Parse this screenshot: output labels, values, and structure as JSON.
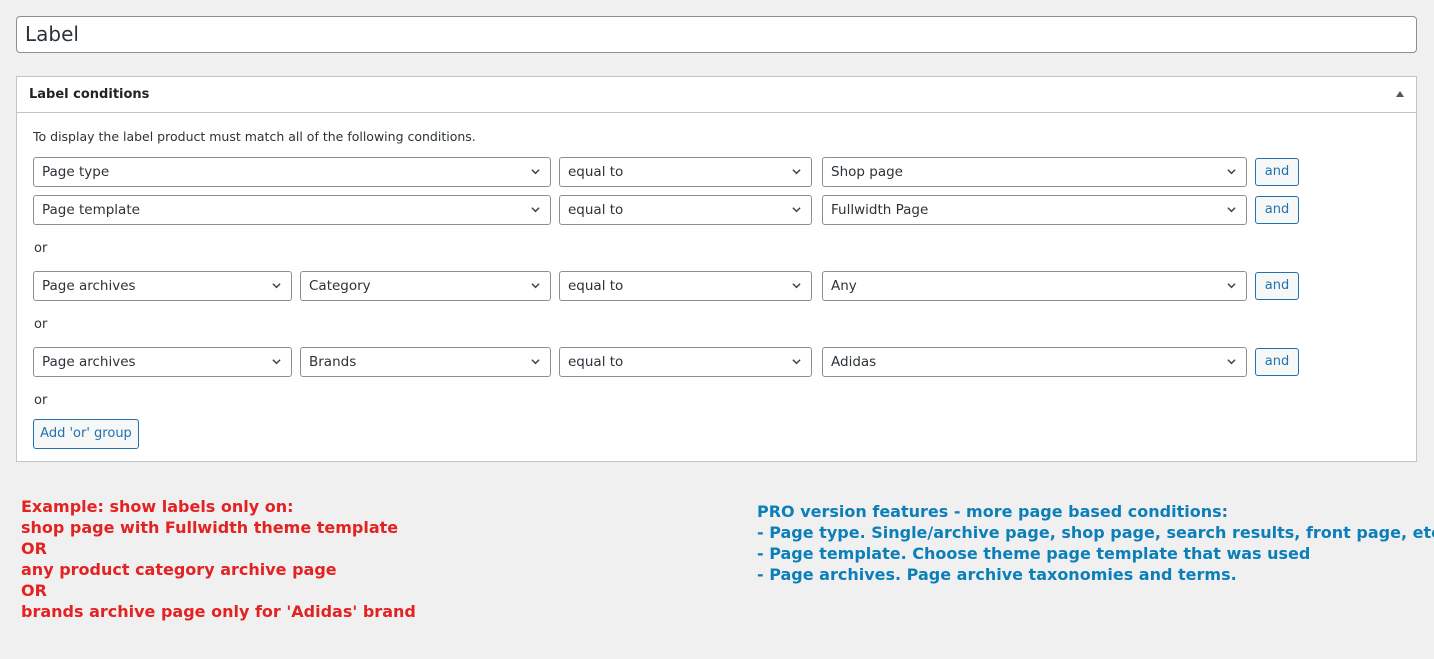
{
  "title_input": {
    "value": "Label"
  },
  "panel": {
    "title": "Label conditions",
    "intro": "To display the label product must match all of the following conditions.",
    "groups": [
      {
        "rows": [
          {
            "fields": [
              "Page type",
              "equal to",
              "Shop page"
            ],
            "and_label": "and"
          },
          {
            "fields": [
              "Page template",
              "equal to",
              "Fullwidth Page"
            ],
            "and_label": "and"
          }
        ]
      },
      {
        "rows": [
          {
            "fields": [
              "Page archives",
              "Category",
              "equal to",
              "Any"
            ],
            "and_label": "and"
          }
        ]
      },
      {
        "rows": [
          {
            "fields": [
              "Page archives",
              "Brands",
              "equal to",
              "Adidas"
            ],
            "and_label": "and"
          }
        ]
      }
    ],
    "or_label": "or",
    "add_or_group_label": "Add 'or' group"
  },
  "example": {
    "lines": [
      "Example: show labels only on:",
      "shop page with Fullwidth theme template",
      "OR",
      "any product category archive page",
      "OR",
      "brands archive page only for 'Adidas' brand"
    ],
    "color": "#e32222"
  },
  "pro": {
    "lines": [
      "PRO version features - more page based conditions:",
      "- Page type. Single/archive page, shop page, search results, front page, etc.",
      "- Page template. Choose theme page template that was used",
      "- Page archives. Page archive taxonomies and terms."
    ],
    "color": "#0c7fb9"
  },
  "colors": {
    "accent": "#2271b1",
    "background": "#f0f0f1"
  },
  "icons": {
    "select_arrow": "chevron-down-icon",
    "panel_toggle": "triangle-up-icon"
  }
}
